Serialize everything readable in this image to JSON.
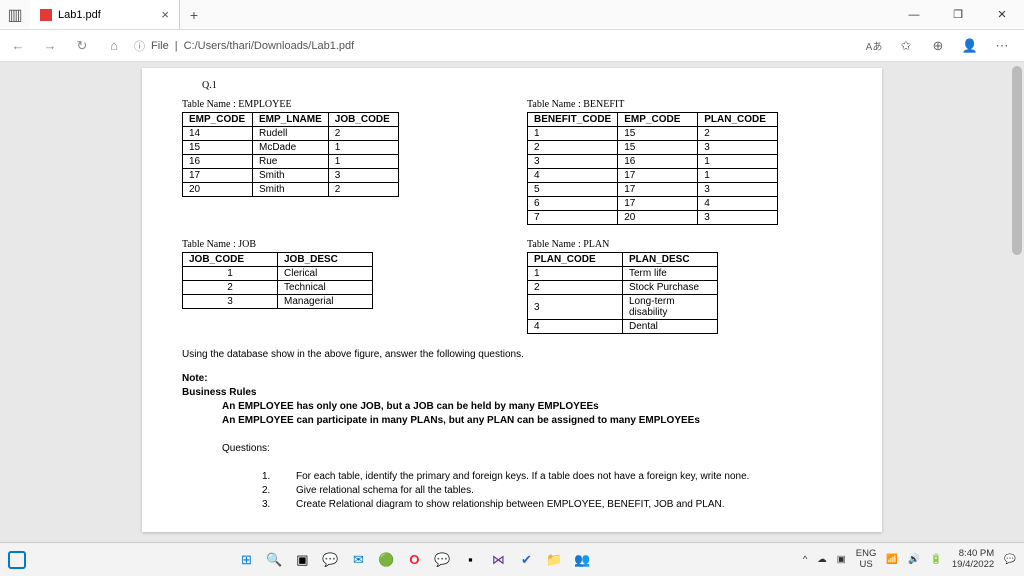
{
  "window": {
    "tab_title": "Lab1.pdf",
    "new_tab": "+",
    "close": "×",
    "minimize": "―",
    "maximize": "❐"
  },
  "address": {
    "back": "←",
    "forward": "→",
    "refresh": "↻",
    "home": "⌂",
    "protocol_icon": "ⓘ",
    "protocol_label": "File",
    "path": "C:/Users/thari/Downloads/Lab1.pdf",
    "icons": {
      "read": "Aあ",
      "fav": "✩",
      "collections": "⊕",
      "profile": "👤",
      "more": "⋯"
    }
  },
  "doc": {
    "qnum": "Q.1",
    "employee": {
      "name": "Table Name : EMPLOYEE",
      "headers": [
        "EMP_CODE",
        "EMP_LNAME",
        "JOB_CODE"
      ],
      "rows": [
        [
          "14",
          "Rudell",
          "2"
        ],
        [
          "15",
          "McDade",
          "1"
        ],
        [
          "16",
          "Rue",
          "1"
        ],
        [
          "17",
          "Smith",
          "3"
        ],
        [
          "20",
          "Smith",
          "2"
        ]
      ]
    },
    "benefit": {
      "name": "Table Name : BENEFIT",
      "headers": [
        "BENEFIT_CODE",
        "EMP_CODE",
        "PLAN_CODE"
      ],
      "rows": [
        [
          "1",
          "15",
          "2"
        ],
        [
          "2",
          "15",
          "3"
        ],
        [
          "3",
          "16",
          "1"
        ],
        [
          "4",
          "17",
          "1"
        ],
        [
          "5",
          "17",
          "3"
        ],
        [
          "6",
          "17",
          "4"
        ],
        [
          "7",
          "20",
          "3"
        ]
      ]
    },
    "job": {
      "name": "Table Name : JOB",
      "headers": [
        "JOB_CODE",
        "JOB_DESC"
      ],
      "rows": [
        [
          "1",
          "Clerical"
        ],
        [
          "2",
          "Technical"
        ],
        [
          "3",
          "Managerial"
        ]
      ]
    },
    "plan": {
      "name": "Table Name : PLAN",
      "headers": [
        "PLAN_CODE",
        "PLAN_DESC"
      ],
      "rows": [
        [
          "1",
          "Term life"
        ],
        [
          "2",
          "Stock Purchase"
        ],
        [
          "3",
          "Long-term disability"
        ],
        [
          "4",
          "Dental"
        ]
      ]
    },
    "intro": "Using the database show in the above figure, answer the following questions.",
    "note_label": "Note:",
    "rules_label": "Business Rules",
    "rule1": "An EMPLOYEE has only one JOB, but a JOB can be held by many EMPLOYEEs",
    "rule2": "An EMPLOYEE can participate in many PLANs, but any PLAN can be assigned to many EMPLOYEEs",
    "questions_label": "Questions:",
    "q1n": "1.",
    "q1": "For each table, identify the primary and foreign keys. If a table does not have a foreign key, write none.",
    "q2n": "2.",
    "q2": "Give relational schema for all the tables.",
    "q3n": "3.",
    "q3": "Create Relational diagram to show relationship between EMPLOYEE, BENEFIT, JOB and PLAN."
  },
  "taskbar": {
    "lang": "ENG",
    "region": "US",
    "time": "8:40 PM",
    "date": "19/4/2022",
    "tray": {
      "chev": "^",
      "cloud": "☁",
      "shield": "▣",
      "wifi": "�wifi",
      "vol": "🔊",
      "bat": "🔋"
    }
  }
}
